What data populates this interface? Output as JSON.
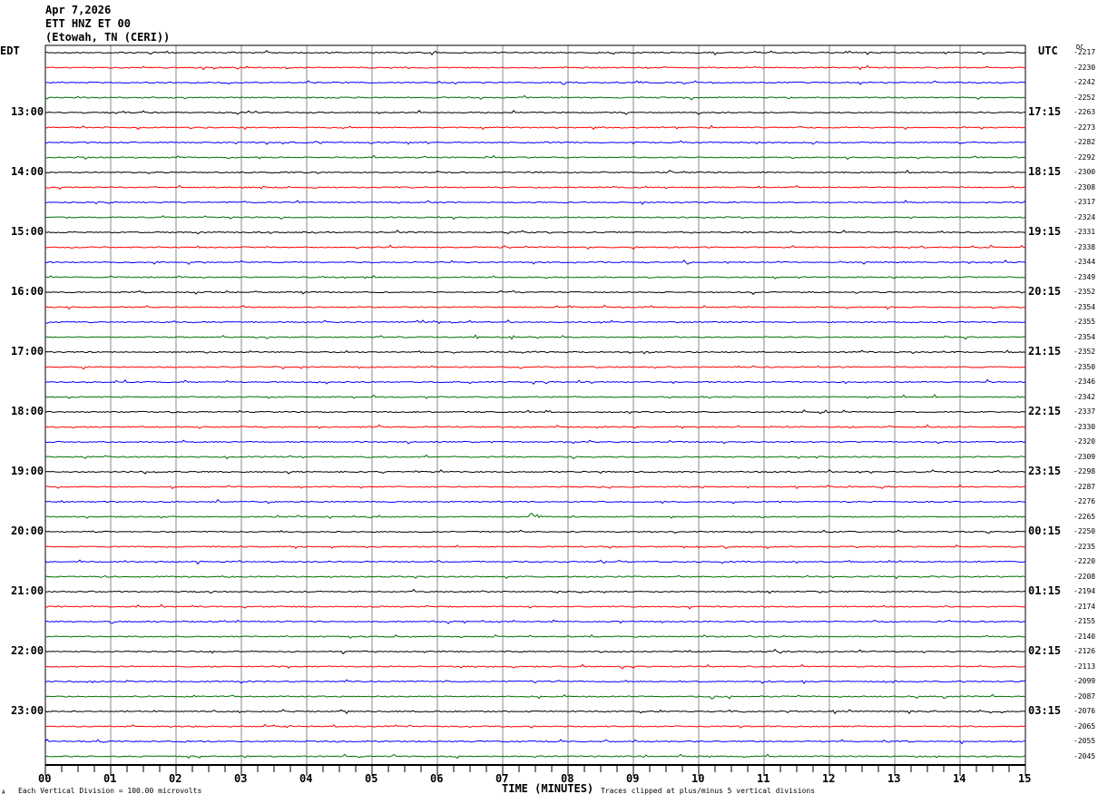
{
  "header": {
    "date": "Apr 7,2026",
    "station": "ETT HNZ ET 00",
    "location": "(Etowah, TN (CERI))"
  },
  "left_axis": {
    "title": "EDT",
    "labels": [
      "13:00",
      "14:00",
      "15:00",
      "16:00",
      "17:00",
      "18:00",
      "19:00",
      "20:00",
      "21:00",
      "22:00",
      "23:00"
    ]
  },
  "right_axis": {
    "title": "UTC",
    "dc_title": "DC",
    "labels": [
      "17:15",
      "18:15",
      "19:15",
      "20:15",
      "21:15",
      "22:15",
      "23:15",
      "00:15",
      "01:15",
      "02:15",
      "03:15"
    ]
  },
  "footer": {
    "scale_note": "Each Vertical Division =  100.00 microvolts",
    "xlabel": "TIME (MINUTES)",
    "clip_note": "Traces clipped at plus/minus 5 vertical divisions",
    "corner_mark": "A"
  },
  "chart_data": {
    "type": "line",
    "title": "ETT HNZ ET 00 helicorder",
    "xlabel": "TIME (MINUTES)",
    "xlim": [
      0,
      15
    ],
    "x_ticks": [
      "00",
      "01",
      "02",
      "03",
      "04",
      "05",
      "06",
      "07",
      "08",
      "09",
      "10",
      "11",
      "12",
      "13",
      "14",
      "15"
    ],
    "trace_count": 48,
    "minutes_per_trace": 15,
    "trace_colors": [
      "#000000",
      "#ff0000",
      "#0000ff",
      "#007000"
    ],
    "dc_offsets": [
      -2217,
      -2230,
      -2242,
      -2252,
      -2263,
      -2273,
      -2282,
      -2292,
      -2300,
      -2308,
      -2317,
      -2324,
      -2331,
      -2338,
      -2344,
      -2349,
      -2352,
      -2354,
      -2355,
      -2354,
      -2352,
      -2350,
      -2346,
      -2342,
      -2337,
      -2330,
      -2320,
      -2309,
      -2298,
      -2287,
      -2276,
      -2265,
      -2250,
      -2235,
      -2220,
      -2208,
      -2194,
      -2174,
      -2155,
      -2140,
      -2126,
      -2113,
      -2099,
      -2087,
      -2076,
      -2065,
      -2055,
      -2045
    ],
    "events": [
      {
        "trace_index": 31,
        "minute": 7.4
      }
    ]
  }
}
